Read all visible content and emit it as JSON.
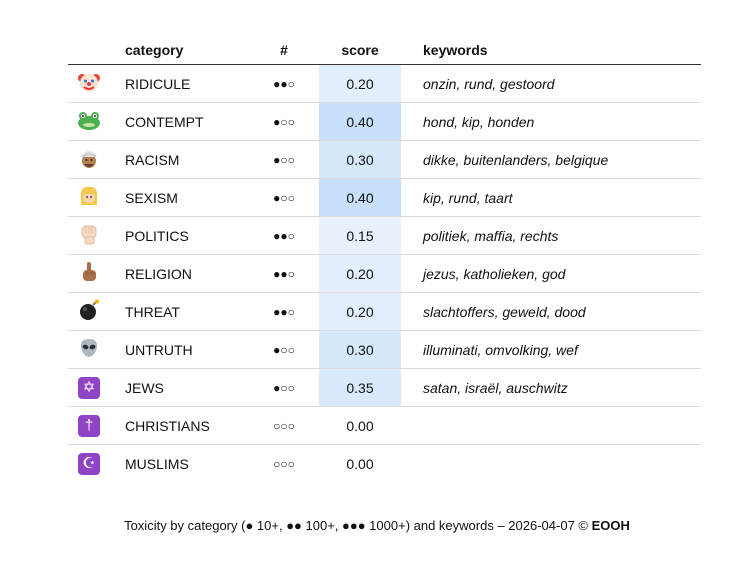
{
  "headers": {
    "icon": "",
    "category": "category",
    "count": "#",
    "score": "score",
    "keywords": "keywords"
  },
  "rows": [
    {
      "icon": "clown-face-icon",
      "category": "RIDICULE",
      "dots": "●●○",
      "score": "0.20",
      "score_color": "#e3effd",
      "keywords": "onzin, rund, gestoord"
    },
    {
      "icon": "frog-face-icon",
      "category": "CONTEMPT",
      "dots": "●○○",
      "score": "0.40",
      "score_color": "#c8e0fb",
      "keywords": "hond, kip, honden"
    },
    {
      "icon": "turbaned-man-icon",
      "category": "RACISM",
      "dots": "●○○",
      "score": "0.30",
      "score_color": "#d6e8fc",
      "keywords": "dikke, buitenlanders, belgique"
    },
    {
      "icon": "blonde-person-icon",
      "category": "SEXISM",
      "dots": "●○○",
      "score": "0.40",
      "score_color": "#c8e0fb",
      "keywords": "kip, rund, taart"
    },
    {
      "icon": "raised-fist-icon",
      "category": "POLITICS",
      "dots": "●●○",
      "score": "0.15",
      "score_color": "#e8f2fd",
      "keywords": "politiek, maffia, rechts"
    },
    {
      "icon": "index-pointing-up-icon",
      "category": "RELIGION",
      "dots": "●●○",
      "score": "0.20",
      "score_color": "#e3effd",
      "keywords": "jezus, katholieken, god"
    },
    {
      "icon": "bomb-icon",
      "category": "THREAT",
      "dots": "●●○",
      "score": "0.20",
      "score_color": "#e3effd",
      "keywords": "slachtoffers, geweld, dood"
    },
    {
      "icon": "alien-icon",
      "category": "UNTRUTH",
      "dots": "●○○",
      "score": "0.30",
      "score_color": "#d6e8fc",
      "keywords": "illuminati, omvolking, wef"
    },
    {
      "icon": "star-of-david-icon",
      "category": "JEWS",
      "dots": "●○○",
      "score": "0.35",
      "score_color": "#d9eafc",
      "keywords": "satan, israël, auschwitz"
    },
    {
      "icon": "latin-cross-icon",
      "category": "CHRISTIANS",
      "dots": "○○○",
      "score": "0.00",
      "score_color": "#ffffff",
      "keywords": ""
    },
    {
      "icon": "star-and-crescent-icon",
      "category": "MUSLIMS",
      "dots": "○○○",
      "score": "0.00",
      "score_color": "#ffffff",
      "keywords": ""
    }
  ],
  "footer": {
    "text": "Toxicity by category (● 10+, ●● 100+, ●●● 1000+) and keywords – 2026-04-07 © ",
    "brand": "EOOH"
  }
}
